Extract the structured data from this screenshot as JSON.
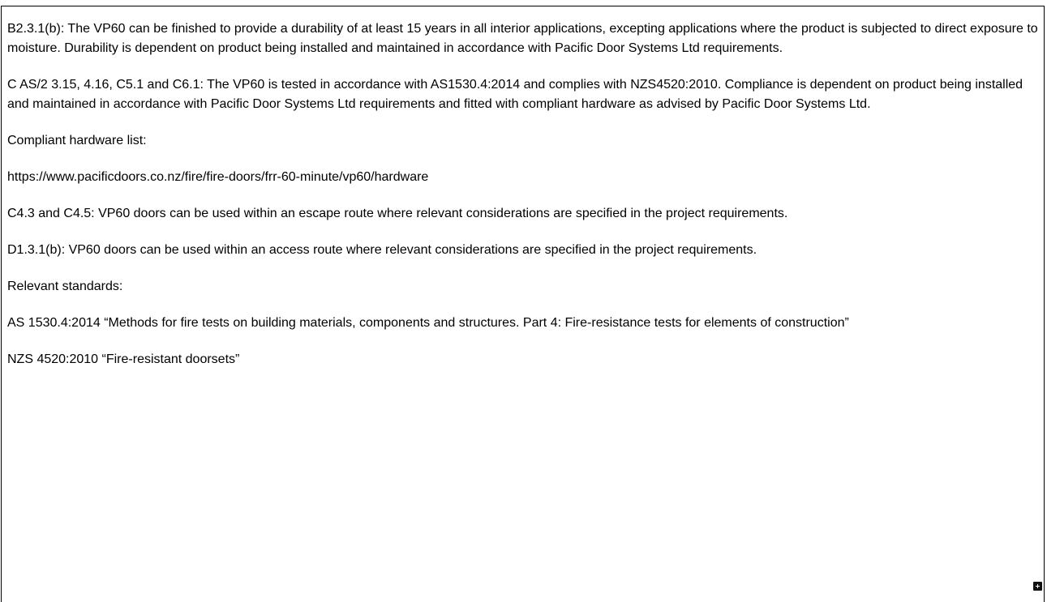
{
  "paragraphs": [
    "B2.3.1(b): The VP60 can be finished to provide a durability of at least 15 years in all interior applications, excepting applications where the product is subjected to direct exposure to moisture. Durability is dependent on product being installed and maintained in accordance with Pacific Door Systems Ltd requirements.",
    "C AS/2 3.15, 4.16, C5.1 and C6.1: The VP60 is tested in accordance with AS1530.4:2014 and complies with NZS4520:2010. Compliance is dependent on product being installed and maintained in accordance with Pacific Door Systems Ltd requirements and fitted with compliant hardware as advised by Pacific Door Systems Ltd.",
    "Compliant hardware list:",
    "https://www.pacificdoors.co.nz/fire/fire-doors/frr-60-minute/vp60/hardware",
    "C4.3 and C4.5: VP60 doors can be used within an escape route where relevant considerations are specified in the project requirements.",
    "D1.3.1(b): VP60 doors can be used within an access route where relevant considerations are specified in the project requirements.",
    "Relevant standards:",
    "AS 1530.4:2014 “Methods for fire tests on building materials, components and structures. Part 4: Fire-resistance tests for elements of construction”",
    "NZS 4520:2010 “Fire-resistant doorsets”"
  ],
  "resize_handle": {
    "icon": "plus-icon"
  }
}
